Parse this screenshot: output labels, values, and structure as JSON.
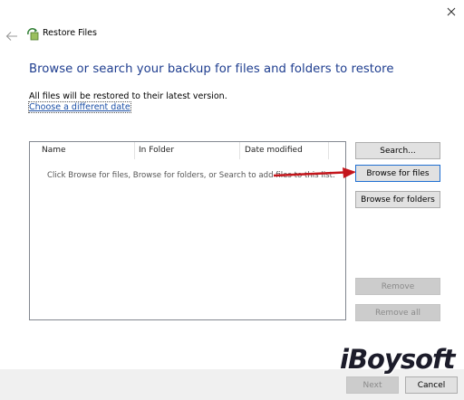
{
  "window": {
    "title": "Restore Files",
    "close_glyph": "×",
    "back_icon": "back-arrow-icon",
    "app_icon": "restore-files-icon"
  },
  "main": {
    "heading": "Browse or search your backup for files and folders to restore",
    "note": "All files will be restored to their latest version.",
    "choose_link": "Choose a different date"
  },
  "file_list": {
    "columns": [
      "Name",
      "In Folder",
      "Date modified"
    ],
    "empty_message": "Click Browse for files, Browse for folders, or Search to add files to this list."
  },
  "buttons": {
    "search": "Search...",
    "browse_files": "Browse for files",
    "browse_folders": "Browse for folders",
    "remove": "Remove",
    "remove_all": "Remove all"
  },
  "footer": {
    "next": "Next",
    "cancel": "Cancel"
  },
  "watermark": "iBoysoft",
  "colors": {
    "heading": "#1e3d8f",
    "link": "#1a4ea6",
    "annotation_arrow": "#c4161c",
    "button_bg": "#e1e1e1",
    "focus_border": "#1f6fd1"
  }
}
